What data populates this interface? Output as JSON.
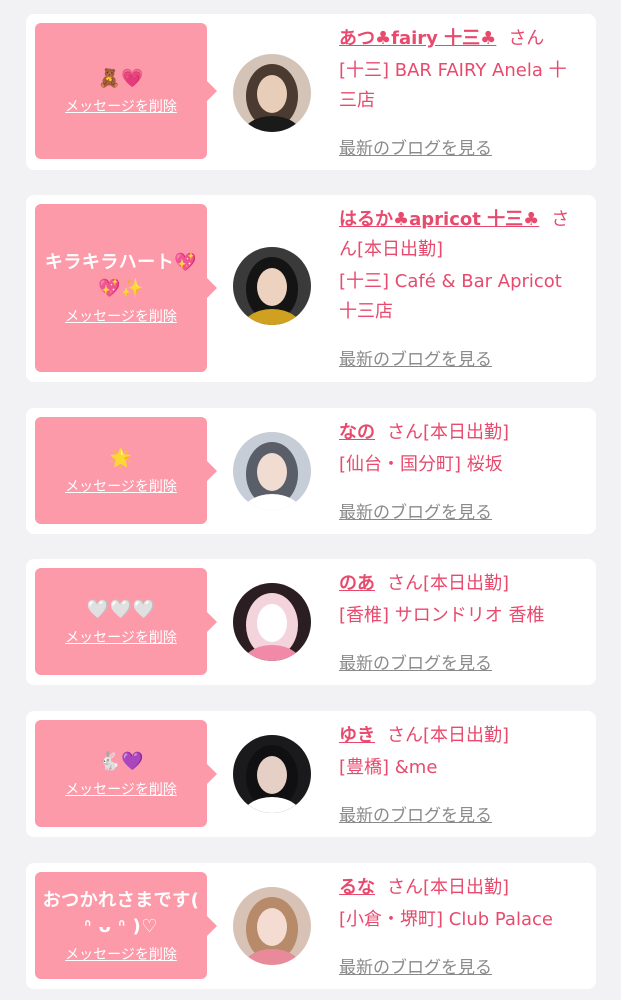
{
  "cards": [
    {
      "message": "🧸💗",
      "delete_label": "メッセージを削除",
      "name": "あつ♣fairy 十三♣",
      "san": "さん",
      "status": "",
      "shop": "[十三] BAR FAIRY Anela 十三店",
      "blog_label": "最新のブログを見る",
      "avatar_colors": {
        "bg": "#d4c4b8",
        "hair": "#4a3a30",
        "face": "#e8cdb8",
        "accent": "#1a1a1a"
      }
    },
    {
      "message": "キラキラハート💖💖✨",
      "delete_label": "メッセージを削除",
      "name": "はるか♣apricot 十三♣",
      "san": "さん",
      "status": "[本日出勤]",
      "shop": "[十三] Café & Bar Apricot 十三店",
      "blog_label": "最新のブログを見る",
      "avatar_colors": {
        "bg": "#3a3a3a",
        "hair": "#141414",
        "face": "#ecd2bf",
        "accent": "#d0a020"
      }
    },
    {
      "message": "🌟",
      "delete_label": "メッセージを削除",
      "name": "なの",
      "san": "さん",
      "status": "[本日出勤]",
      "shop": "[仙台・国分町] 桜坂",
      "blog_label": "最新のブログを見る",
      "avatar_colors": {
        "bg": "#c7cdd6",
        "hair": "#5a5e68",
        "face": "#f0dcd0",
        "accent": "#ffffff"
      }
    },
    {
      "message": "🤍🤍🤍",
      "delete_label": "メッセージを削除",
      "name": "のあ",
      "san": "さん",
      "status": "[本日出勤]",
      "shop": "[香椎] サロンドリオ 香椎",
      "blog_label": "最新のブログを見る",
      "avatar_colors": {
        "bg": "#2a1e22",
        "hair": "#f4d4dc",
        "face": "#ffffff",
        "accent": "#f08aa8"
      }
    },
    {
      "message": "🐇💜",
      "delete_label": "メッセージを削除",
      "name": "ゆき",
      "san": "さん",
      "status": "[本日出勤]",
      "shop": "[豊橋] &me",
      "blog_label": "最新のブログを見る",
      "avatar_colors": {
        "bg": "#1a1a1c",
        "hair": "#101012",
        "face": "#e6d0c6",
        "accent": "#ffffff"
      }
    },
    {
      "message": "おつかれさまです( ᐢ ᴗ ᐢ )♡",
      "delete_label": "メッセージを削除",
      "name": "るな",
      "san": "さん",
      "status": "[本日出勤]",
      "shop": "[小倉・堺町] Club Palace",
      "blog_label": "最新のブログを見る",
      "avatar_colors": {
        "bg": "#d8c2b6",
        "hair": "#b78a6a",
        "face": "#f4dcd2",
        "accent": "#e88a9a"
      }
    }
  ]
}
